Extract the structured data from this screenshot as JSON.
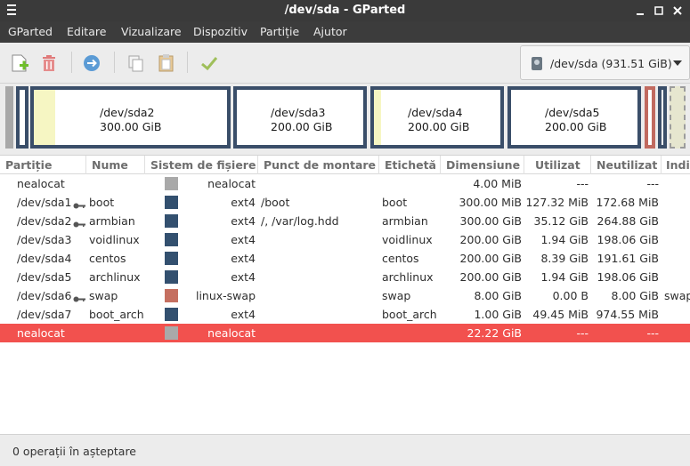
{
  "window": {
    "title": "/dev/sda - GParted"
  },
  "menubar": {
    "items": [
      "GParted",
      "Editare",
      "Vizualizare",
      "Dispozitiv",
      "Partiție",
      "Ajutor"
    ]
  },
  "toolbar": {
    "buttons": [
      "new-partition-icon",
      "delete-icon",
      "resize-move-icon",
      "copy-icon",
      "paste-icon",
      "apply-icon"
    ],
    "device_selector": {
      "label": "/dev/sda  (931.51 GiB)",
      "icon": "harddisk-icon"
    }
  },
  "colors": {
    "ext4": "#33506f",
    "linux-swap": "#c56f60",
    "unallocated": "#a9a9a9",
    "used_space": "#f6f6c3",
    "selection": "#f2514e"
  },
  "disk_map": {
    "partitions": [
      {
        "name": "/dev/sda2",
        "size": "300.00 GiB"
      },
      {
        "name": "/dev/sda3",
        "size": "200.00 GiB"
      },
      {
        "name": "/dev/sda4",
        "size": "200.00 GiB"
      },
      {
        "name": "/dev/sda5",
        "size": "200.00 GiB"
      }
    ]
  },
  "table": {
    "columns": [
      "Partiție",
      "Nume",
      "Sistem de fișiere",
      "Punct de montare",
      "Etichetă",
      "Dimensiune",
      "Utilizat",
      "Neutilizat",
      "Indi"
    ],
    "rows": [
      {
        "partition": "nealocat",
        "name": "",
        "fs": "nealocat",
        "mount": "",
        "label": "",
        "size": "4.00 MiB",
        "used": "---",
        "unused": "---",
        "flags": "",
        "fs_color": "#a9a9a9",
        "key": false
      },
      {
        "partition": "/dev/sda1",
        "name": "boot",
        "fs": "ext4",
        "mount": "/boot",
        "label": "boot",
        "size": "300.00 MiB",
        "used": "127.32 MiB",
        "unused": "172.68 MiB",
        "flags": "",
        "fs_color": "#33506f",
        "key": true
      },
      {
        "partition": "/dev/sda2",
        "name": "armbian",
        "fs": "ext4",
        "mount": "/, /var/log.hdd",
        "label": "armbian",
        "size": "300.00 GiB",
        "used": "35.12 GiB",
        "unused": "264.88 GiB",
        "flags": "",
        "fs_color": "#33506f",
        "key": true
      },
      {
        "partition": "/dev/sda3",
        "name": "voidlinux",
        "fs": "ext4",
        "mount": "",
        "label": "voidlinux",
        "size": "200.00 GiB",
        "used": "1.94 GiB",
        "unused": "198.06 GiB",
        "flags": "",
        "fs_color": "#33506f",
        "key": false
      },
      {
        "partition": "/dev/sda4",
        "name": "centos",
        "fs": "ext4",
        "mount": "",
        "label": "centos",
        "size": "200.00 GiB",
        "used": "8.39 GiB",
        "unused": "191.61 GiB",
        "flags": "",
        "fs_color": "#33506f",
        "key": false
      },
      {
        "partition": "/dev/sda5",
        "name": "archlinux",
        "fs": "ext4",
        "mount": "",
        "label": "archlinux",
        "size": "200.00 GiB",
        "used": "1.94 GiB",
        "unused": "198.06 GiB",
        "flags": "",
        "fs_color": "#33506f",
        "key": false
      },
      {
        "partition": "/dev/sda6",
        "name": "swap",
        "fs": "linux-swap",
        "mount": "",
        "label": "swap",
        "size": "8.00 GiB",
        "used": "0.00 B",
        "unused": "8.00 GiB",
        "flags": "swap",
        "fs_color": "#c56f60",
        "key": true
      },
      {
        "partition": "/dev/sda7",
        "name": "boot_arch",
        "fs": "ext4",
        "mount": "",
        "label": "boot_arch",
        "size": "1.00 GiB",
        "used": "49.45 MiB",
        "unused": "974.55 MiB",
        "flags": "",
        "fs_color": "#33506f",
        "key": false
      },
      {
        "partition": "nealocat",
        "name": "",
        "fs": "nealocat",
        "mount": "",
        "label": "",
        "size": "22.22 GiB",
        "used": "---",
        "unused": "---",
        "flags": "",
        "fs_color": "#a9a9a9",
        "key": false,
        "selected": true
      }
    ]
  },
  "status": {
    "text": "0 operații în așteptare"
  }
}
